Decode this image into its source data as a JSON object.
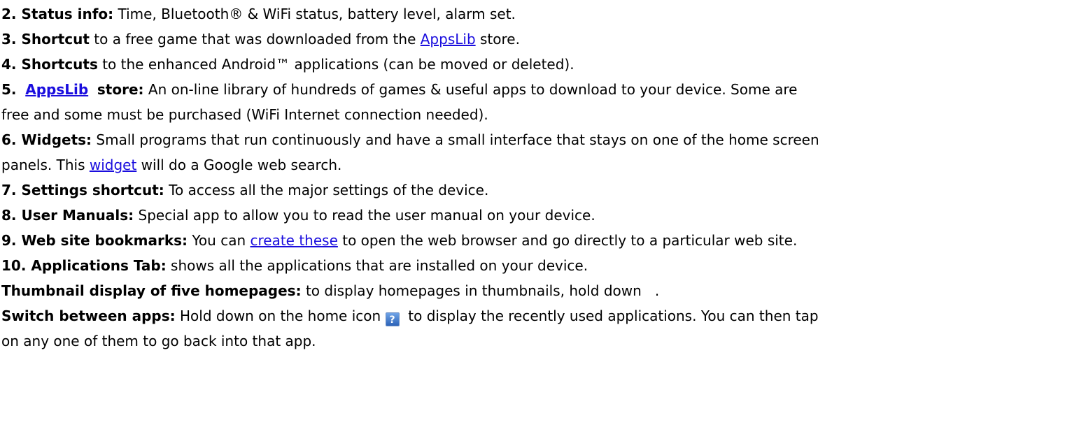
{
  "colors": {
    "link": "#1a0dde",
    "help_icon_fill": "#2c63b8"
  },
  "items": {
    "status": {
      "label": "2. Status info:",
      "text": " Time, Bluetooth® & WiFi status, battery level, alarm set."
    },
    "shortcut": {
      "label": "3. Shortcut",
      "pre": " to a free game that was downloaded from the ",
      "link": "AppsLib",
      "post": " store."
    },
    "shortcuts": {
      "label": "4. Shortcuts",
      "text": " to the enhanced Android™ applications (can be moved or deleted)."
    },
    "appslib": {
      "num": "5.",
      "link": "AppsLib",
      "label": "store:",
      "line1": "  An on-line library of hundreds of games & useful apps to download to your device. Some are",
      "line2": "free and some must be purchased (WiFi Internet connection needed)."
    },
    "widgets": {
      "label": "6. Widgets:",
      "line1": " Small programs that run continuously and have a small interface that stays on one of the home screen",
      "pre2": "panels. This ",
      "link": "widget",
      "post2": " will do a Google web search."
    },
    "settings": {
      "label": "7. Settings shortcut:",
      "text": " To access all the major settings of the device."
    },
    "manuals": {
      "label": "8. User Manuals:",
      "text": " Special app to allow you to read the user manual on your device."
    },
    "bookmarks": {
      "label": "9. Web site bookmarks:",
      "pre": " You can ",
      "link": "create these",
      "post": " to open the web browser and go directly to a particular web site."
    },
    "apps_tab": {
      "label": "10. Applications Tab:",
      "text": " shows all the applications that are installed on your device."
    },
    "thumbnail": {
      "label": "Thumbnail display of five homepages:",
      "text": " to display homepages in thumbnails, hold down   ."
    },
    "switch": {
      "label": "Switch between apps:",
      "pre": " Hold down on the home icon ",
      "icon_glyph": "?",
      "post": "  to display the recently used applications. You can then tap",
      "line2": "on any one of them to go back into that app."
    }
  }
}
